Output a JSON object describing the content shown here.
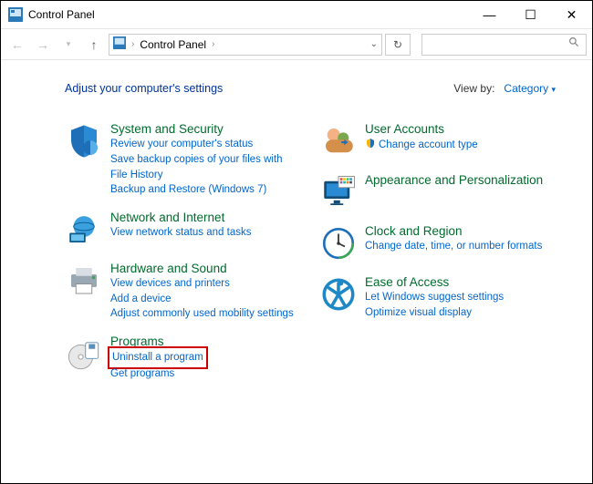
{
  "window": {
    "title": "Control Panel",
    "breadcrumb": "Control Panel",
    "minimize": "—",
    "maximize": "☐",
    "close": "✕"
  },
  "viewby": {
    "label": "View by:",
    "value": "Category",
    "caret": "▾"
  },
  "heading": "Adjust your computer's settings",
  "left": {
    "c1": {
      "title": "System and Security",
      "l1": "Review your computer's status",
      "l2": "Save backup copies of your files with File History",
      "l3": "Backup and Restore (Windows 7)"
    },
    "c2": {
      "title": "Network and Internet",
      "l1": "View network status and tasks"
    },
    "c3": {
      "title": "Hardware and Sound",
      "l1": "View devices and printers",
      "l2": "Add a device",
      "l3": "Adjust commonly used mobility settings"
    },
    "c4": {
      "title": "Programs",
      "l1": "Uninstall a program",
      "l2": "Get programs"
    }
  },
  "right": {
    "c1": {
      "title": "User Accounts",
      "l1": "Change account type"
    },
    "c2": {
      "title": "Appearance and Personalization"
    },
    "c3": {
      "title": "Clock and Region",
      "l1": "Change date, time, or number formats"
    },
    "c4": {
      "title": "Ease of Access",
      "l1": "Let Windows suggest settings",
      "l2": "Optimize visual display"
    }
  }
}
